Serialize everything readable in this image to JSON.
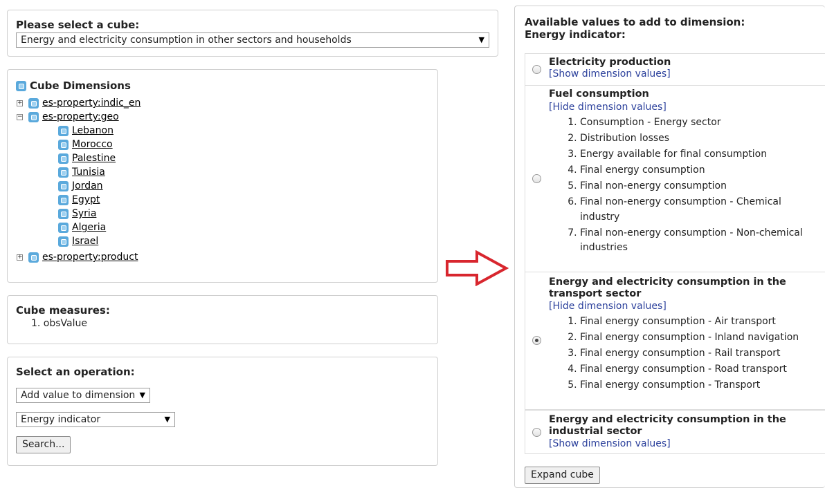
{
  "cube_select": {
    "title": "Please select a cube:",
    "selected": "Energy and electricity consumption in other sectors and households"
  },
  "dimensions": {
    "title": "Cube Dimensions",
    "items": [
      {
        "toggle": "+",
        "label": "es-property:indic_en"
      },
      {
        "toggle": "−",
        "label": "es-property:geo"
      },
      {
        "toggle": "+",
        "label": "es-property:product"
      }
    ],
    "geo_values": [
      "Lebanon",
      "Morocco",
      "Palestine",
      "Tunisia",
      "Jordan",
      "Egypt",
      "Syria",
      "Algeria",
      "Israel"
    ]
  },
  "measures": {
    "title": "Cube measures:",
    "items": [
      "1.  obsValue"
    ]
  },
  "operation": {
    "title": "Select an operation:",
    "op_selected": "Add value to dimension",
    "dim_selected": "Energy indicator",
    "search_label": "Search..."
  },
  "right": {
    "title": "Available values to add to dimension: Energy indicator:",
    "options": [
      {
        "name": "Electricity production",
        "toggle": "[Show dimension values]",
        "checked": false,
        "values": []
      },
      {
        "name": "Fuel consumption",
        "toggle": "[Hide dimension values]",
        "checked": false,
        "values": [
          "Consumption - Energy sector",
          "Distribution losses",
          "Energy available for final consumption",
          "Final energy consumption",
          "Final non-energy consumption",
          "Final non-energy consumption - Chemical industry",
          "Final non-energy consumption - Non-chemical industries"
        ]
      },
      {
        "name": "Energy and electricity consumption in the transport sector",
        "toggle": "[Hide dimension values]",
        "checked": true,
        "values": [
          "Final energy consumption - Air transport",
          "Final energy consumption - Inland navigation",
          "Final energy consumption - Rail transport",
          "Final energy consumption - Road transport",
          "Final energy consumption - Transport"
        ]
      },
      {
        "name": "Energy and electricity consumption in the industrial sector",
        "toggle": "[Show dimension values]",
        "checked": false,
        "values": []
      }
    ],
    "expand_label": "Expand cube"
  },
  "colors": {
    "arrow": "#d8262e",
    "link_blue": "#2a3f9b",
    "cube_icon": "#5aa9dc"
  }
}
